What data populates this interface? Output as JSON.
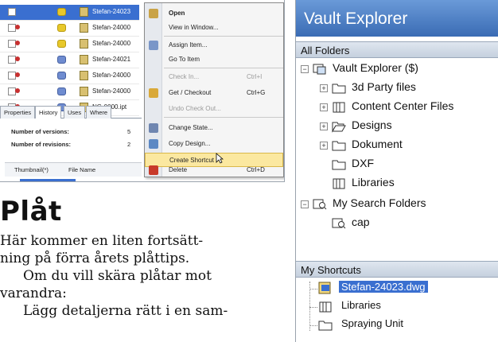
{
  "file_list": {
    "rows": [
      {
        "name": "Stefan-24023"
      },
      {
        "name": "Stefan-24000"
      },
      {
        "name": "Stefan-24000"
      },
      {
        "name": "Stefan-24021"
      },
      {
        "name": "Stefan-24000"
      },
      {
        "name": "Stefan-24000"
      },
      {
        "name": "NG-0000.ipt"
      }
    ]
  },
  "context_menu": {
    "items": [
      {
        "label": "Open",
        "shortcut": ""
      },
      {
        "label": "View in Window...",
        "shortcut": ""
      },
      {
        "label": "Assign Item...",
        "shortcut": ""
      },
      {
        "label": "Go To Item",
        "shortcut": ""
      },
      {
        "label": "Check In...",
        "shortcut": "Ctrl+I"
      },
      {
        "label": "Get / Checkout",
        "shortcut": "Ctrl+G"
      },
      {
        "label": "Undo Check Out...",
        "shortcut": ""
      },
      {
        "label": "Change State...",
        "shortcut": ""
      },
      {
        "label": "Copy Design...",
        "shortcut": ""
      },
      {
        "label": "Create Shortcut",
        "shortcut": ""
      },
      {
        "label": "Delete",
        "shortcut": "Ctrl+D"
      }
    ]
  },
  "tabs": [
    "Properties",
    "History",
    "Uses",
    "Where"
  ],
  "properties": {
    "versions_label": "Number of versions:",
    "versions_value": "5",
    "revisions_label": "Number of revisions:",
    "revisions_value": "2",
    "col_thumb": "Thumbnail(*)",
    "col_file": "File Name"
  },
  "article": {
    "heading": "Plåt",
    "p1": "Här kommer en liten fortsätt-",
    "p2": "ning på förra årets plåttips.",
    "p3": "Om du vill skära plåtar mot",
    "p4": "varandra:",
    "p5": "Lägg detaljerna rätt i en sam-"
  },
  "vault": {
    "title": "Vault Explorer",
    "all_folders": "All Folders",
    "tree": [
      {
        "label": "Vault Explorer ($)",
        "icon": "vault-icon"
      },
      {
        "label": "3d Party files",
        "icon": "folder-icon"
      },
      {
        "label": "Content Center Files",
        "icon": "library-icon"
      },
      {
        "label": "Designs",
        "icon": "open-folder-icon"
      },
      {
        "label": "Dokument",
        "icon": "folder-icon"
      },
      {
        "label": "DXF",
        "icon": "folder-icon"
      },
      {
        "label": "Libraries",
        "icon": "library-icon"
      },
      {
        "label": "My Search Folders",
        "icon": "search-folder-icon"
      },
      {
        "label": "cap",
        "icon": "search-folder-icon"
      }
    ],
    "my_shortcuts": "My Shortcuts",
    "shortcuts": [
      {
        "label": "Stefan-24023.dwg"
      },
      {
        "label": "Libraries"
      },
      {
        "label": "Spraying Unit"
      }
    ]
  }
}
